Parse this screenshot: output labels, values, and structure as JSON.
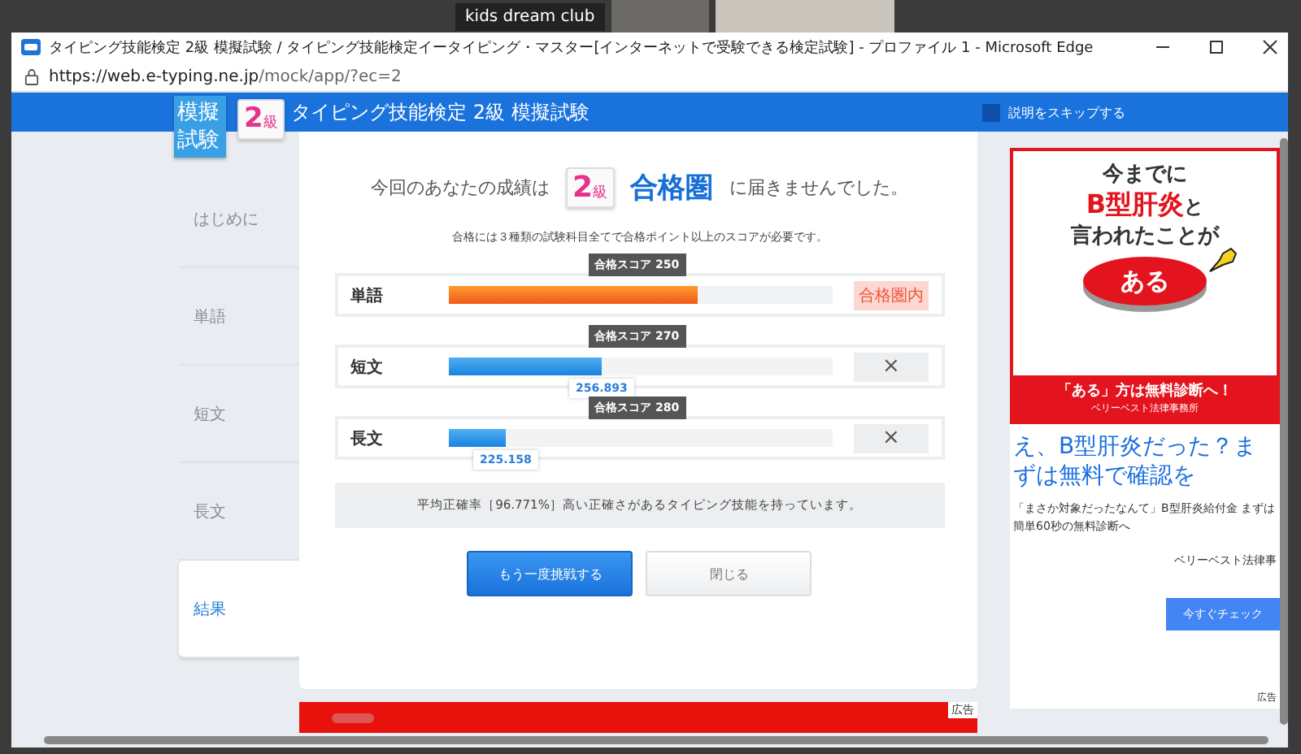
{
  "meeting": {
    "participant": "kids dream club"
  },
  "window": {
    "title": "タイピング技能検定 2級 模擬試験 / タイピング技能検定イータイピング・マスター[インターネットで受験できる検定試験] - プロファイル 1 - Microsoft Edge",
    "url_host": "https://web.e-typing.ne.jp",
    "url_path": "/mock/app/?ec=2"
  },
  "header": {
    "logo": "模擬試験",
    "grade": {
      "number": "2",
      "unit": "級"
    },
    "title": "タイピング技能検定 2級 模擬試験",
    "skip": {
      "label": "説明をスキップする",
      "checked": true
    }
  },
  "sidebar": {
    "items": [
      {
        "label": "はじめに",
        "selected": false
      },
      {
        "label": "単語",
        "selected": false
      },
      {
        "label": "短文",
        "selected": false
      },
      {
        "label": "長文",
        "selected": false
      },
      {
        "label": "結果",
        "selected": true
      }
    ]
  },
  "result": {
    "lead": "今回のあなたの成績は",
    "grade": {
      "number": "2",
      "unit": "級"
    },
    "zone": "合格圏",
    "tail": "に届きませんでした。",
    "note": "合格には３種類の試験科目全てで合格ポイント以上のスコアが必要です。",
    "rows": [
      {
        "subject": "単語",
        "target": "合格スコア 250",
        "level": 0.65,
        "passed": true,
        "verdict": "合格圏内"
      },
      {
        "subject": "短文",
        "target": "合格スコア 270",
        "level": 0.4,
        "passed": false,
        "verdict": "×",
        "score": "256.893"
      },
      {
        "subject": "長文",
        "target": "合格スコア 280",
        "level": 0.15,
        "passed": false,
        "verdict": "×",
        "score": "225.158"
      }
    ],
    "accuracy": "平均正確率［96.771%］高い正確さがあるタイピング技能を持っています。",
    "buttons": [
      {
        "label": "もう一度挑戦する",
        "kind": "primary"
      },
      {
        "label": "閉じる",
        "kind": "secondary"
      }
    ]
  },
  "ad": {
    "line1": "今までに",
    "line2": "B型肝炎",
    "line2_tail": "と",
    "line3": "言われたことが",
    "button": "ある",
    "band": "「ある」方は無料診断へ！",
    "sponsor": "ベリーベスト法律事務所",
    "headline": "え、B型肝炎だった？まずは無料で確認を",
    "body": "「まさか対象だったなんて」B型肝炎給付金 まずは簡単60秒の無料診断へ",
    "advertiser": "ベリーベスト法律事",
    "cta": "今すぐチェック",
    "label": "広告"
  },
  "bottom_ad": {
    "label": "広告"
  }
}
